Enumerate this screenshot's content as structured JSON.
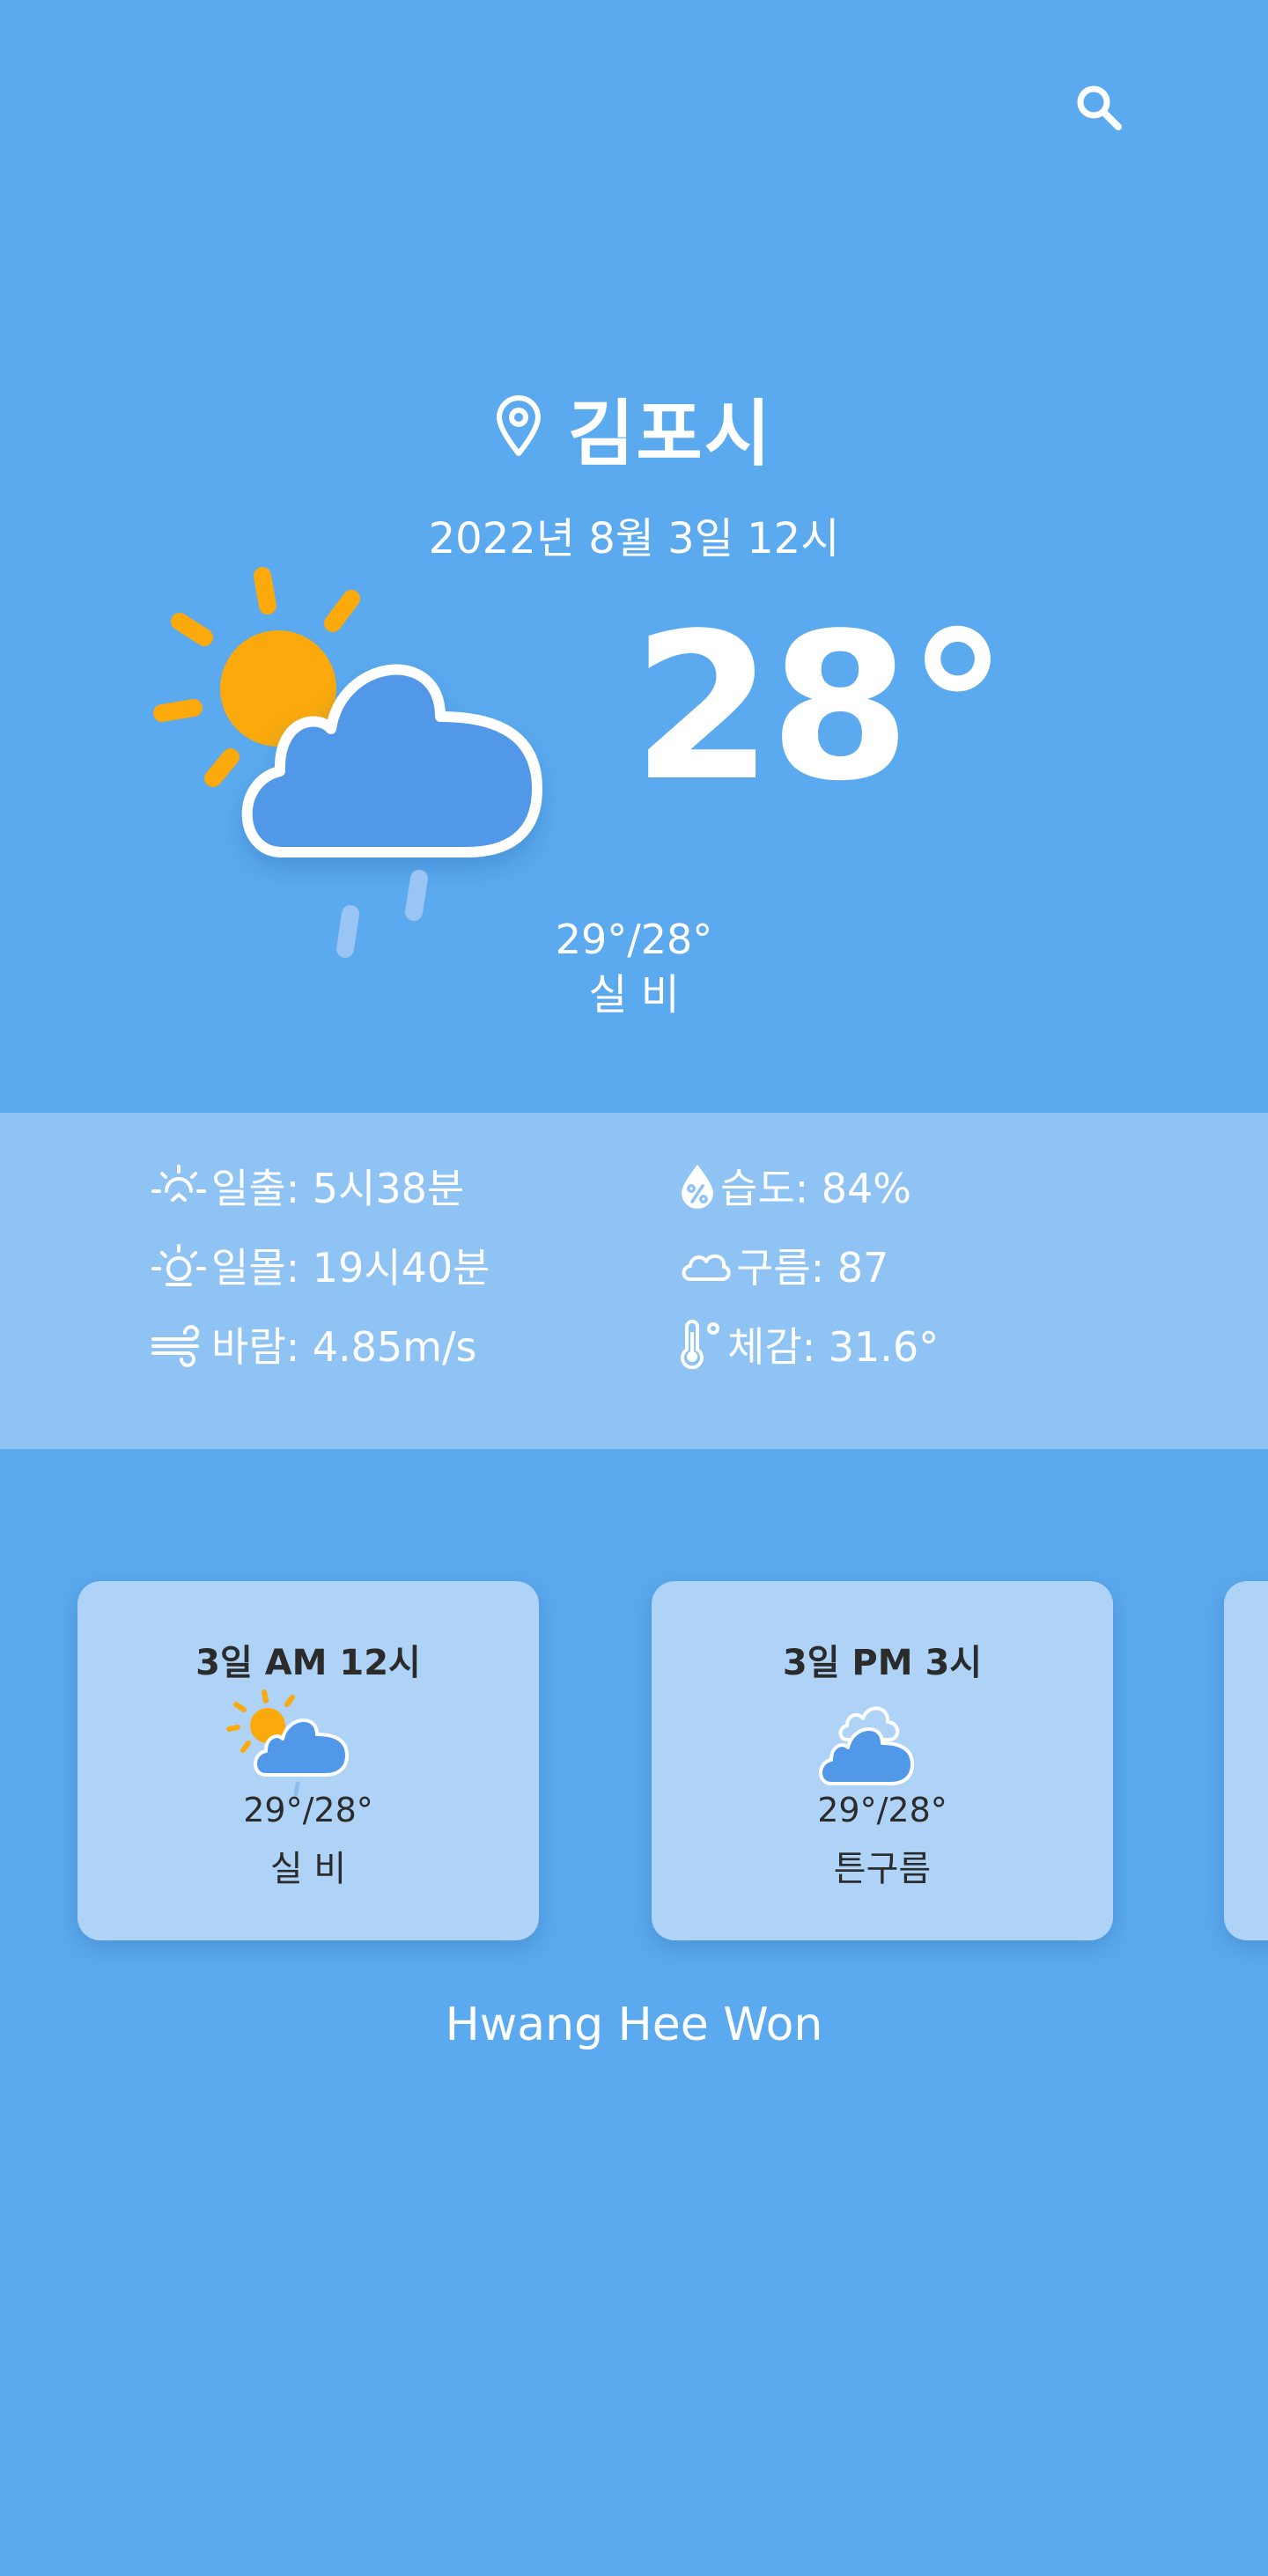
{
  "location": {
    "city": "김포시",
    "icon": "location-pin-icon"
  },
  "search": {
    "icon": "search-icon"
  },
  "current": {
    "datetime": "2022년 8월 3일 12시",
    "temperature": "28°",
    "temp_range": "29°/28°",
    "condition": "실 비",
    "icon": "sun-cloud-rain-icon"
  },
  "details": {
    "sunrise": "일출: 5시38분",
    "sunset": "일몰: 19시40분",
    "wind": "바람: 4.85m/s",
    "humidity": "습도: 84%",
    "clouds": "구름: 87",
    "feels_like": "체감: 31.6°"
  },
  "forecast": [
    {
      "title": "3일 AM 12시",
      "temp_range": "29°/28°",
      "condition": "실 비",
      "icon": "sun-cloud-rain-icon"
    },
    {
      "title": "3일 PM 3시",
      "temp_range": "29°/28°",
      "condition": "튼구름",
      "icon": "broken-clouds-icon"
    }
  ],
  "footer": {
    "author": "Hwang Hee Won"
  },
  "colors": {
    "background": "#5ba9ee",
    "details_band": "#8ec3f4",
    "card": "#aed3f7",
    "sun": "#fba90b",
    "cloud_fill": "#5198e8"
  }
}
